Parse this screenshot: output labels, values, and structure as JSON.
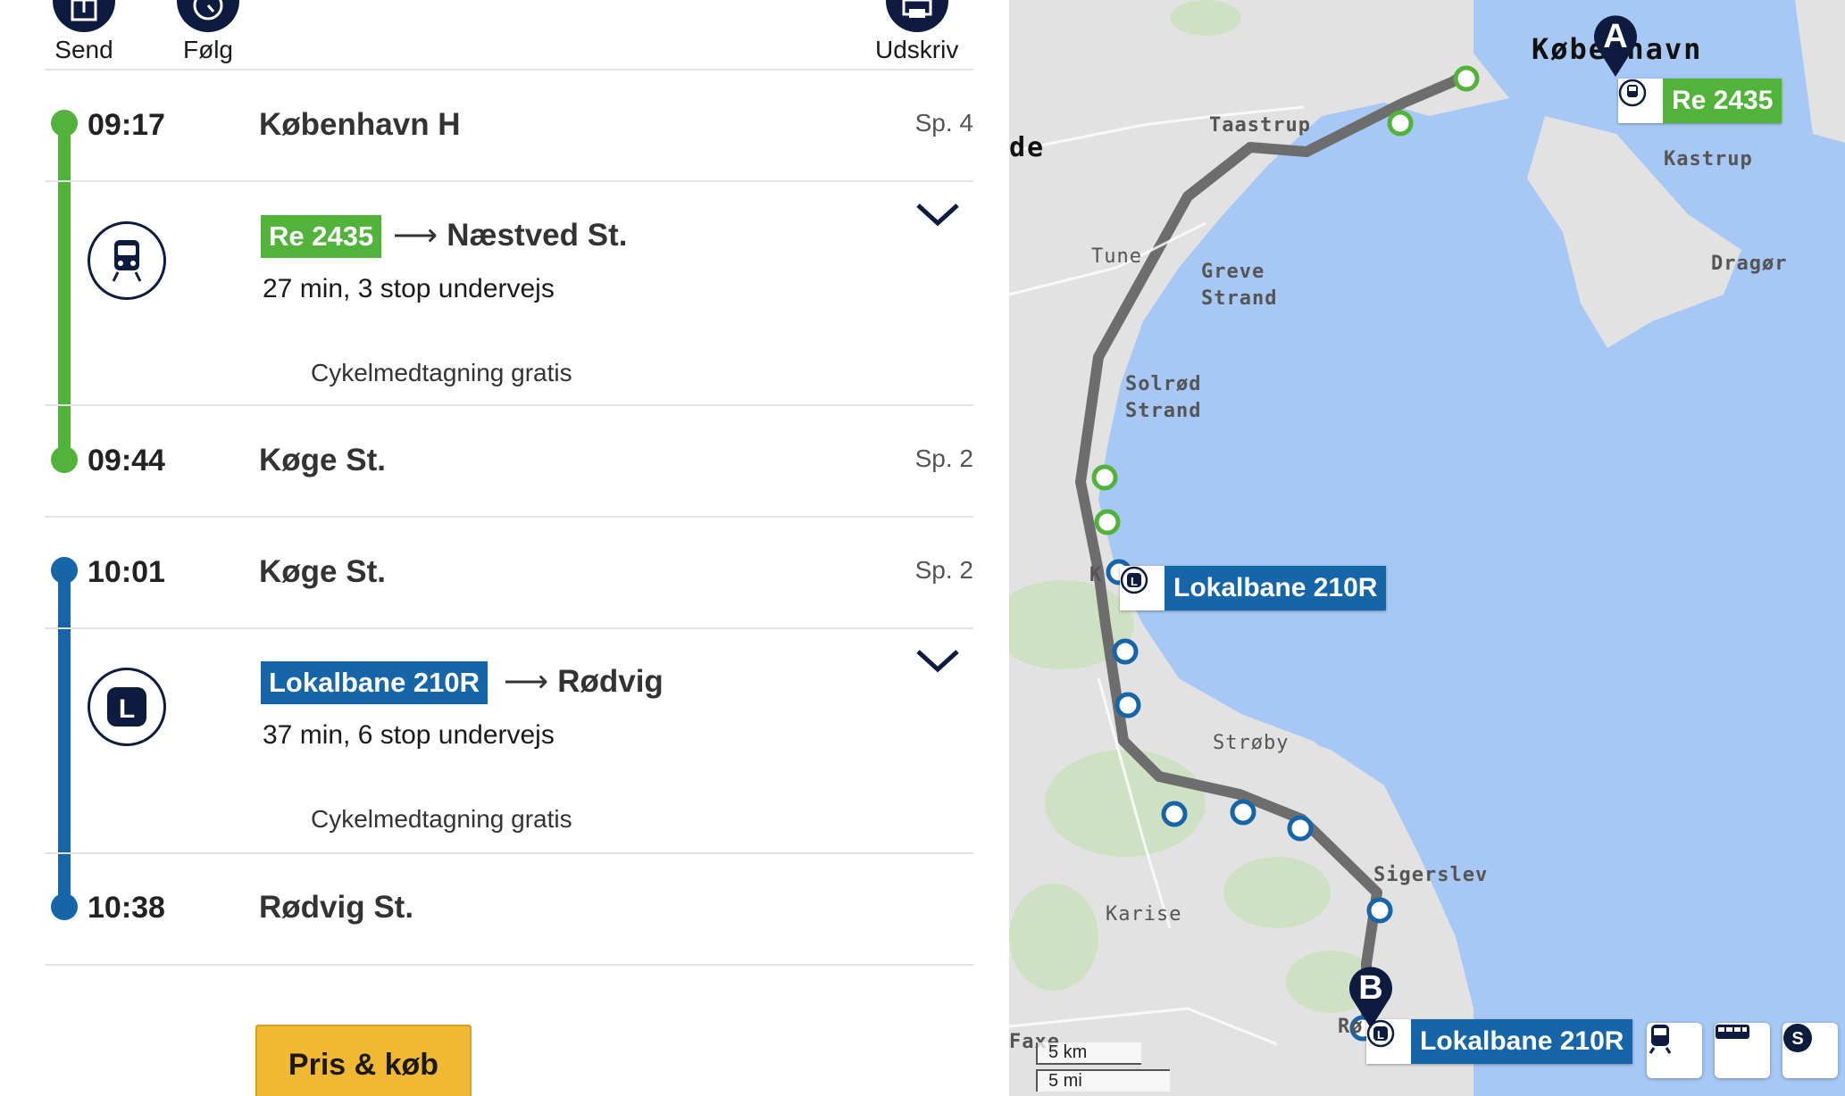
{
  "toolbar": {
    "send_label": "Send",
    "follow_label": "Følg",
    "print_label": "Udskriv"
  },
  "legs": [
    {
      "color": "#52b33b",
      "departure": {
        "time": "09:17",
        "station": "København H",
        "track": "Sp. 4"
      },
      "line": "Re 2435",
      "line_type": "train-icon",
      "destination": "Næstved St.",
      "duration": "27 min, 3 stop undervejs",
      "note": "Cykelmedtagning gratis",
      "arrival": {
        "time": "09:44",
        "station": "Køge St.",
        "track": "Sp. 2"
      }
    },
    {
      "color": "#1565a8",
      "departure": {
        "time": "10:01",
        "station": "Køge St.",
        "track": "Sp. 2"
      },
      "line": "Lokalbane 210R",
      "line_type": "local-train-icon",
      "destination": "Rødvig",
      "duration": "37 min, 6 stop undervejs",
      "note": "Cykelmedtagning gratis",
      "arrival": {
        "time": "10:38",
        "station": "Rødvig St.",
        "track": ""
      }
    }
  ],
  "arrow": "⟶",
  "buy_button": "Pris & køb",
  "map": {
    "place_labels": {
      "copenhagen": "København",
      "taastrup": "Taastrup",
      "kastrup": "Kastrup",
      "dragor": "Dragør",
      "tune": "Tune",
      "greve": "Greve\nStrand",
      "solrod": "Solrød\nStrand",
      "stroby": "Strøby",
      "sigerslev": "Sigerslev",
      "karise": "Karise",
      "edge_de": "de",
      "edge_faxe": "Faxe",
      "edge_k": "K",
      "edge_ro": "Rø"
    },
    "tag_re": "Re 2435",
    "tag_lokal_1": "Lokalbane 210R",
    "tag_lokal_2": "Lokalbane 210R",
    "pin_a": "A",
    "pin_b": "B",
    "scale_km": "5 km",
    "scale_mi": "5 mi",
    "filter_buttons": [
      "train-icon",
      "bus-icon",
      "s-train-icon"
    ]
  }
}
